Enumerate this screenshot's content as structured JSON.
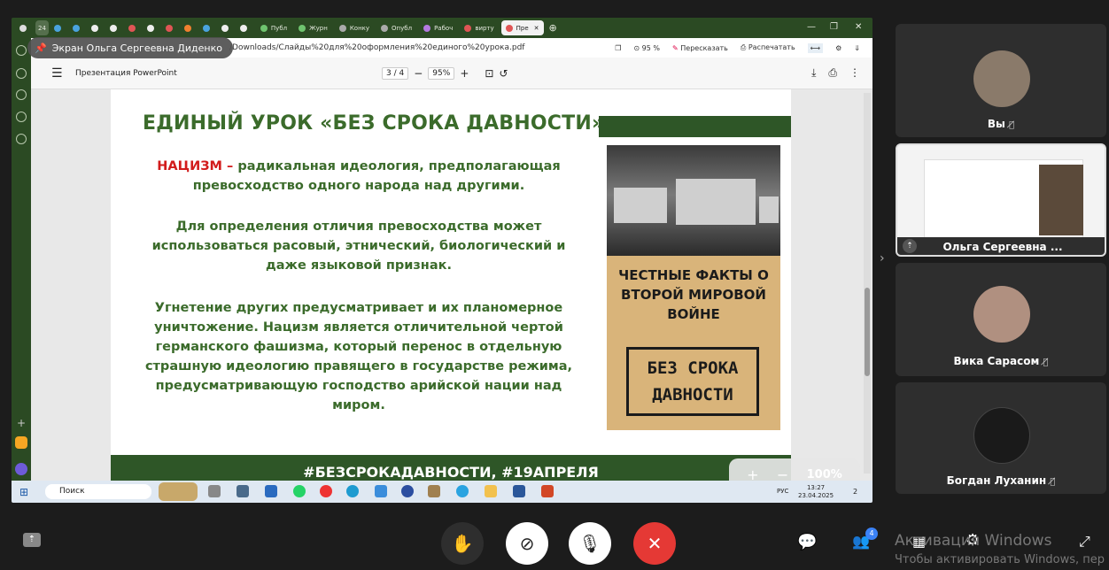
{
  "browser": {
    "tabs": [
      "24",
      "Публ",
      "Журн",
      "Конку",
      "Опубл",
      "Рабоч",
      "вирту",
      "Пре"
    ],
    "url": "/Downloads/Слайды%20для%20оформления%20единого%20урока.pdf",
    "zoom": "95 %",
    "retell": "Пересказать",
    "print": "Распечатать"
  },
  "screen_share_label": "Экран Ольга Сергеевна Диденко",
  "pdf": {
    "title": "Презентация PowerPoint",
    "page": "3",
    "page_total": "/ 4",
    "zoom": "95%"
  },
  "slide": {
    "heading": "ЕДИНЫЙ УРОК «БЕЗ СРОКА ДАВНОСТИ»",
    "p1_red": "НАЦИЗМ –",
    "p1_text": " радикальная идеология, предполагающая превосходство одного народа над другими.",
    "p2": "Для определения отличия превосходства может использоваться расовый, этнический, биологический и даже языковой признак.",
    "p3": "Угнетение других предусматривает и их планомерное уничтожение. Нацизм является отличительной чертой германского фашизма, который перенос в отдельную страшную идеологию правящего в государстве режима, предусматривающую господство арийской нации над миром.",
    "book_title": "ЧЕСТНЫЕ ФАКТЫ О ВТОРОЙ МИРОВОЙ ВОЙНЕ",
    "book_stamp": "БЕЗ СРОКА ДАВНОСТИ",
    "footer": "#БЕЗСРОКАДАВНОСТИ, #19АПРЕЛЯ"
  },
  "zoom_overlay": {
    "plus": "+",
    "minus": "−",
    "value": "100%"
  },
  "taskbar": {
    "search": "Поиск",
    "lang": "РУС",
    "time": "13:27",
    "date": "23.04.2025",
    "notif": "2"
  },
  "participants": [
    {
      "name": "Вы"
    },
    {
      "name": "Ольга Сергеевна ..."
    },
    {
      "name": "Вика Сарасом"
    },
    {
      "name": "Богдан Луханин"
    }
  ],
  "call": {
    "people_count": "4"
  },
  "watermark": {
    "line1": "Активация Windows",
    "line2": "Чтобы активировать Windows, пер"
  },
  "colors": {
    "green": "#2e5627",
    "text_green": "#3b6b2b",
    "red": "#d21b1b",
    "hangup": "#e53935"
  }
}
